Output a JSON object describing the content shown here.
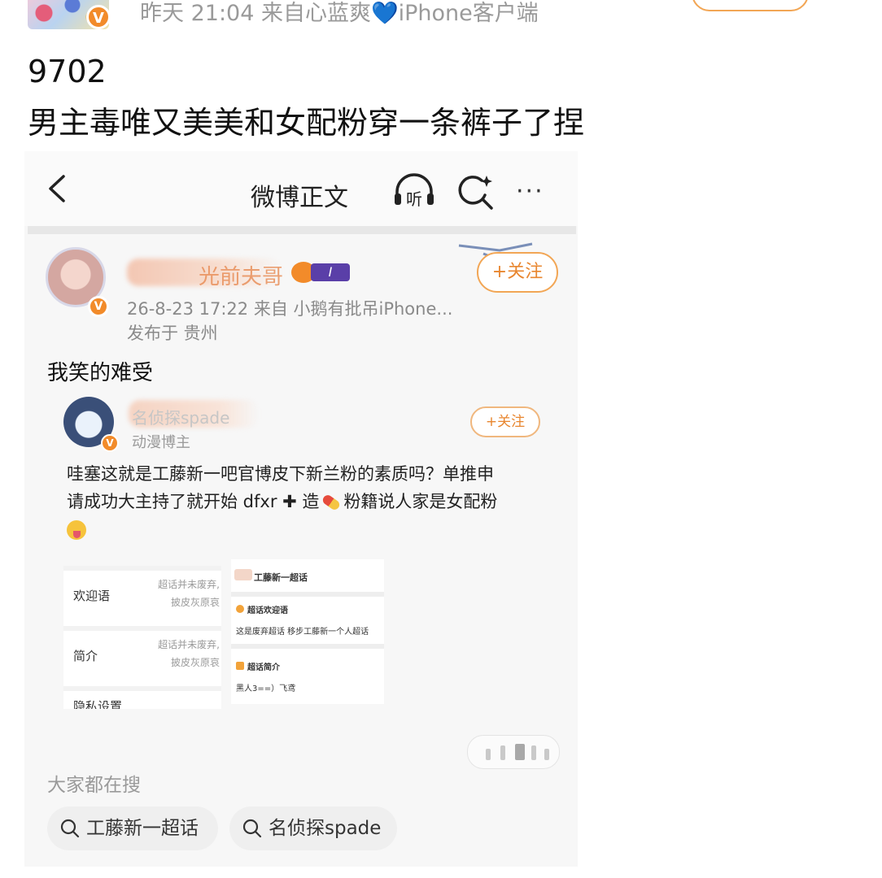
{
  "outer_post": {
    "meta": "昨天 21:04  来自心蓝爽💙iPhone客户端",
    "meta_prefix": "昨天 21:04  来自心蓝爽",
    "meta_heart": "💙",
    "meta_suffix": "iPhone客户端",
    "verified_mark": "V",
    "number": "9702",
    "text": "男主毒唯又美美和女配粉穿一条裤子了捏"
  },
  "screenshot": {
    "nav": {
      "title": "微博正文",
      "listen_label": "听",
      "more_label": "···"
    },
    "post": {
      "author_partial": "光前夫哥",
      "level_badge": "I",
      "verified_mark": "V",
      "follow_label": "+关注",
      "meta": "26-8-23 17:22  来自 小鹅有批吊iPhone...",
      "location": "发布于 贵州",
      "body": "我笑的难受"
    },
    "repost": {
      "author_partial": "名侦探spade",
      "role": "动漫博主",
      "verified_mark": "V",
      "follow_label": "+关注",
      "text_line1": "哇塞这就是工藤新一吧官博皮下新兰粉的素质吗？单推申",
      "text_line2_a": "请成功大主持了就开始 dfxr ",
      "text_line2_plus": "✚",
      "text_line2_b": " 造",
      "text_line2_c": "粉籍说人家是女配粉",
      "inner_left": {
        "row1_label": "欢迎语",
        "row1_val_1": "超话并未废弃,",
        "row1_val_2": "披皮灰原哀",
        "row2_label": "简介",
        "row2_val_1": "超话并未废弃,",
        "row2_val_2": "披皮灰原哀",
        "row3_label": "隐私设置"
      },
      "inner_right": {
        "title": "工藤新一超话",
        "welcome_heading": "超话欢迎语",
        "welcome_text": "这是废弃超话 移步工藤新一个人超话",
        "intro_heading": "超话简介",
        "intro_text": "黑人3==）飞鸢"
      }
    },
    "search": {
      "heading": "大家都在搜",
      "chips": [
        "工藤新一超话",
        "名侦探spade"
      ]
    }
  },
  "colors": {
    "accent_orange": "#f28b2a",
    "follow_border": "#f2a655",
    "muted_text": "#9a9a9a"
  },
  "icons": [
    "back-arrow-icon",
    "listen-headphone-icon",
    "search-sparkle-icon",
    "more-dots-icon",
    "search-icon"
  ]
}
